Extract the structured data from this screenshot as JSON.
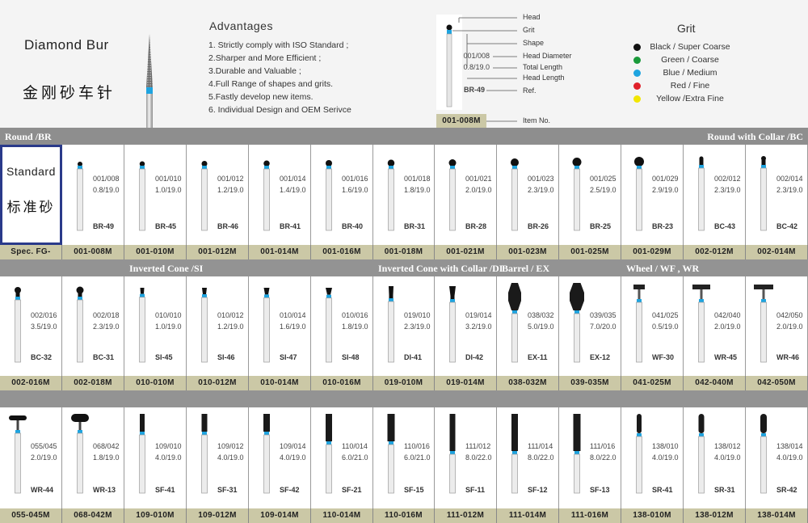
{
  "header": {
    "title": "Diamond Bur",
    "title_cn": "金刚砂车针",
    "advantages_title": "Advantages",
    "advantages": [
      "1. Strictly comply with ISO Standard ;",
      "2.Sharper and More Efficient ;",
      "3.Durable and Valuable ;",
      "4.Full Range of shapes and grits.",
      "5.Fastly develop new items.",
      "6. Individual Design and OEM Serivce"
    ]
  },
  "legend": {
    "labels": [
      "Head",
      "Grit",
      "Shape",
      "Head Diameter",
      "Total Length",
      "Head Length",
      "Ref.",
      "Item No."
    ],
    "example_spec1": "001/008",
    "example_spec2": "0.8/19.0",
    "example_ref": "BR-49",
    "example_code": "001-008M"
  },
  "grit": {
    "title": "Grit",
    "items": [
      {
        "label": "Black / Super Coarse",
        "color": "#111111"
      },
      {
        "label": "Green / Coarse",
        "color": "#1a9a3a"
      },
      {
        "label": "Blue / Medium",
        "color": "#1ea4e0"
      },
      {
        "label": "Red / Fine",
        "color": "#e0202a"
      },
      {
        "label": "Yellow /Extra Fine",
        "color": "#f2e600"
      }
    ]
  },
  "standard": {
    "label": "Standard",
    "label_cn": "标准砂",
    "spec_label": "Spec. FG-"
  },
  "rows": [
    {
      "items": [
        {
          "spec1": "001/008",
          "spec2": "0.8/19.0",
          "ref": "BR-49",
          "code": "001-008M",
          "shape": "round",
          "size": 4
        },
        {
          "spec1": "001/010",
          "spec2": "1.0/19.0",
          "ref": "BR-45",
          "code": "001-010M",
          "shape": "round",
          "size": 4.5
        },
        {
          "spec1": "001/012",
          "spec2": "1.2/19.0",
          "ref": "BR-46",
          "code": "001-012M",
          "shape": "round",
          "size": 5
        },
        {
          "spec1": "001/014",
          "spec2": "1.4/19.0",
          "ref": "BR-41",
          "code": "001-014M",
          "shape": "round",
          "size": 5.5
        },
        {
          "spec1": "001/016",
          "spec2": "1.6/19.0",
          "ref": "BR-40",
          "code": "001-016M",
          "shape": "round",
          "size": 6
        },
        {
          "spec1": "001/018",
          "spec2": "1.8/19.0",
          "ref": "BR-31",
          "code": "001-018M",
          "shape": "round",
          "size": 6.5
        },
        {
          "spec1": "001/021",
          "spec2": "2.0/19.0",
          "ref": "BR-28",
          "code": "001-021M",
          "shape": "round",
          "size": 7
        },
        {
          "spec1": "001/023",
          "spec2": "2.3/19.0",
          "ref": "BR-26",
          "code": "001-023M",
          "shape": "round",
          "size": 8
        },
        {
          "spec1": "001/025",
          "spec2": "2.5/19.0",
          "ref": "BR-25",
          "code": "001-025M",
          "shape": "round",
          "size": 9
        },
        {
          "spec1": "001/029",
          "spec2": "2.9/19.0",
          "ref": "BR-23",
          "code": "001-029M",
          "shape": "round",
          "size": 10
        },
        {
          "spec1": "002/012",
          "spec2": "2.3/19.0",
          "ref": "BC-43",
          "code": "002-012M",
          "shape": "collar",
          "size": 5
        },
        {
          "spec1": "002/014",
          "spec2": "2.3/19.0",
          "ref": "BC-42",
          "code": "002-014M",
          "shape": "collar",
          "size": 6
        }
      ],
      "labels": [
        {
          "text": "Round /BR",
          "col": 1
        },
        {
          "text": "Round with Collar /BC",
          "col": 12
        }
      ]
    },
    {
      "items": [
        {
          "spec1": "002/016",
          "spec2": "3.5/19.0",
          "ref": "BC-32",
          "code": "002-016M",
          "shape": "collar",
          "size": 8
        },
        {
          "spec1": "002/018",
          "spec2": "2.3/19.0",
          "ref": "BC-31",
          "code": "002-018M",
          "shape": "collar",
          "size": 9
        },
        {
          "spec1": "010/010",
          "spec2": "1.0/19.0",
          "ref": "SI-45",
          "code": "010-010M",
          "shape": "inverted",
          "size": 5
        },
        {
          "spec1": "010/012",
          "spec2": "1.2/19.0",
          "ref": "SI-46",
          "code": "010-012M",
          "shape": "inverted",
          "size": 6
        },
        {
          "spec1": "010/014",
          "spec2": "1.6/19.0",
          "ref": "SI-47",
          "code": "010-014M",
          "shape": "inverted",
          "size": 7
        },
        {
          "spec1": "010/016",
          "spec2": "1.8/19.0",
          "ref": "SI-48",
          "code": "010-016M",
          "shape": "inverted",
          "size": 8
        },
        {
          "spec1": "019/010",
          "spec2": "2.3/19.0",
          "ref": "DI-41",
          "code": "019-010M",
          "shape": "invcollar",
          "size": 6
        },
        {
          "spec1": "019/014",
          "spec2": "3.2/19.0",
          "ref": "DI-42",
          "code": "019-014M",
          "shape": "invcollar",
          "size": 8
        },
        {
          "spec1": "038/032",
          "spec2": "5.0/19.0",
          "ref": "EX-11",
          "code": "038-032M",
          "shape": "barrel",
          "size": 16
        },
        {
          "spec1": "039/035",
          "spec2": "7.0/20.0",
          "ref": "EX-12",
          "code": "039-035M",
          "shape": "barrel",
          "size": 18
        },
        {
          "spec1": "041/025",
          "spec2": "0.5/19.0",
          "ref": "WF-30",
          "code": "041-025M",
          "shape": "wheel",
          "size": 14
        },
        {
          "spec1": "042/040",
          "spec2": "2.0/19.0",
          "ref": "WR-45",
          "code": "042-040M",
          "shape": "wheel",
          "size": 22
        },
        {
          "spec1": "042/050",
          "spec2": "2.0/19.0",
          "ref": "WR-46",
          "code": "042-050M",
          "shape": "wheel",
          "size": 24
        }
      ],
      "labels": [
        {
          "text": "Inverted Cone /SI",
          "col": 3
        },
        {
          "text": "Inverted Cone with Collar /DI",
          "col": 7
        },
        {
          "text": "Barrel / EX",
          "col": 9
        },
        {
          "text": "Wheel / WF , WR",
          "col": 11
        }
      ]
    },
    {
      "items": [
        {
          "spec1": "055/045",
          "spec2": "2.0/19.0",
          "ref": "WR-44",
          "code": "055-045M",
          "shape": "wheelround",
          "size": 22
        },
        {
          "spec1": "068/042",
          "spec2": "1.8/19.0",
          "ref": "WR-13",
          "code": "068-042M",
          "shape": "pill",
          "size": 22
        },
        {
          "spec1": "109/010",
          "spec2": "4.0/19.0",
          "ref": "SF-41",
          "code": "109-010M",
          "shape": "flat",
          "size": 6
        },
        {
          "spec1": "109/012",
          "spec2": "4.0/19.0",
          "ref": "SF-31",
          "code": "109-012M",
          "shape": "flat",
          "size": 7
        },
        {
          "spec1": "109/014",
          "spec2": "4.0/19.0",
          "ref": "SF-42",
          "code": "109-014M",
          "shape": "flat",
          "size": 8
        },
        {
          "spec1": "110/014",
          "spec2": "6.0/21.0",
          "ref": "SF-21",
          "code": "110-014M",
          "shape": "flatlong",
          "size": 8
        },
        {
          "spec1": "110/016",
          "spec2": "6.0/21.0",
          "ref": "SF-15",
          "code": "110-016M",
          "shape": "flatlong",
          "size": 9
        },
        {
          "spec1": "111/012",
          "spec2": "8.0/22.0",
          "ref": "SF-11",
          "code": "111-012M",
          "shape": "flatxlong",
          "size": 7
        },
        {
          "spec1": "111/014",
          "spec2": "8.0/22.0",
          "ref": "SF-12",
          "code": "111-014M",
          "shape": "flatxlong",
          "size": 8
        },
        {
          "spec1": "111/016",
          "spec2": "8.0/22.0",
          "ref": "SF-13",
          "code": "111-016M",
          "shape": "flatxlong",
          "size": 9
        },
        {
          "spec1": "138/010",
          "spec2": "4.0/19.0",
          "ref": "SR-41",
          "code": "138-010M",
          "shape": "roundend",
          "size": 6
        },
        {
          "spec1": "138/012",
          "spec2": "4.0/19.0",
          "ref": "SR-31",
          "code": "138-012M",
          "shape": "roundend",
          "size": 7
        },
        {
          "spec1": "138/014",
          "spec2": "4.0/19.0",
          "ref": "SR-42",
          "code": "138-014M",
          "shape": "roundend",
          "size": 8
        }
      ],
      "labels": []
    }
  ]
}
